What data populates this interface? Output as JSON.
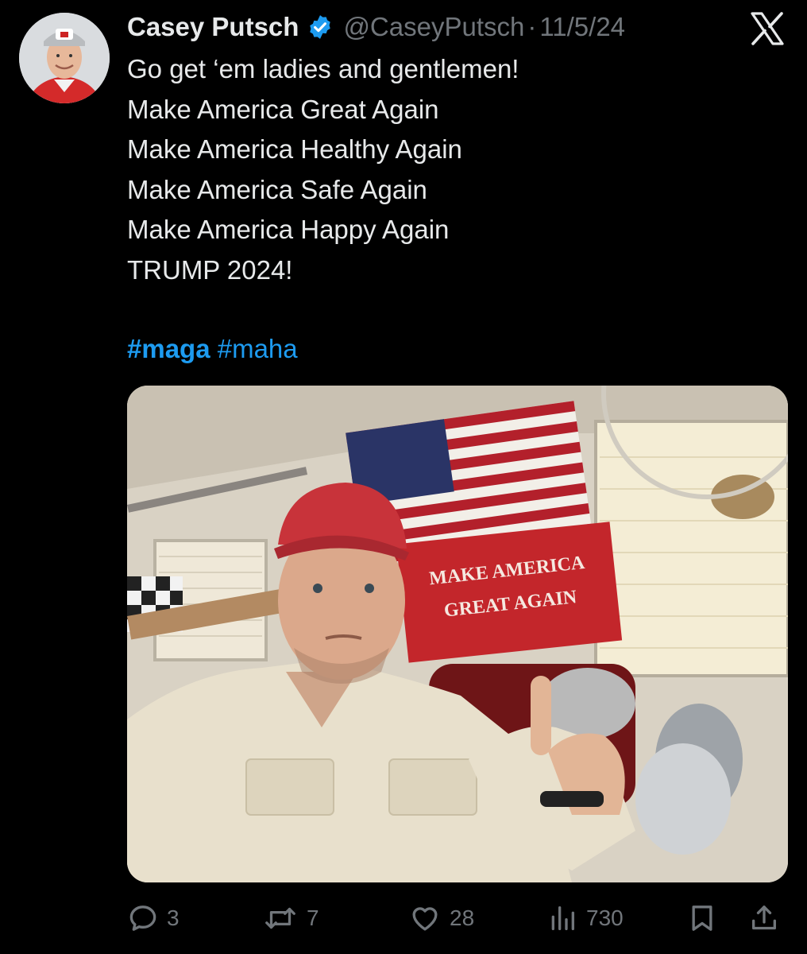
{
  "tweet": {
    "author": {
      "display_name": "Casey Putsch",
      "handle": "@CaseyPutsch",
      "verified": true,
      "avatar": "avatar-photo"
    },
    "separator": "·",
    "date": "11/5/24",
    "platform_icon": "x-logo-icon",
    "lines": [
      "Go get ‘em ladies and gentlemen!",
      "Make America Great Again",
      "Make America Healthy Again",
      "Make America Safe Again",
      "Make America Happy Again",
      "TRUMP 2024!"
    ],
    "hashtags": [
      "#maga",
      "#maha"
    ],
    "media": {
      "banner_text_line1": "MAKE AMERICA",
      "banner_text_line2": "GREAT AGAIN"
    },
    "actions": {
      "replies": "3",
      "reposts": "7",
      "likes": "28",
      "views": "730",
      "reply_icon": "reply-bubble-icon",
      "repost_icon": "repost-arrows-icon",
      "like_icon": "heart-icon",
      "views_icon": "views-bars-icon",
      "bookmark_icon": "bookmark-icon",
      "share_icon": "share-upload-icon"
    }
  },
  "colors": {
    "background": "#000000",
    "text": "#e7e9ea",
    "muted": "#71767b",
    "link": "#1d9bf0",
    "verified": "#1d9bf0"
  }
}
